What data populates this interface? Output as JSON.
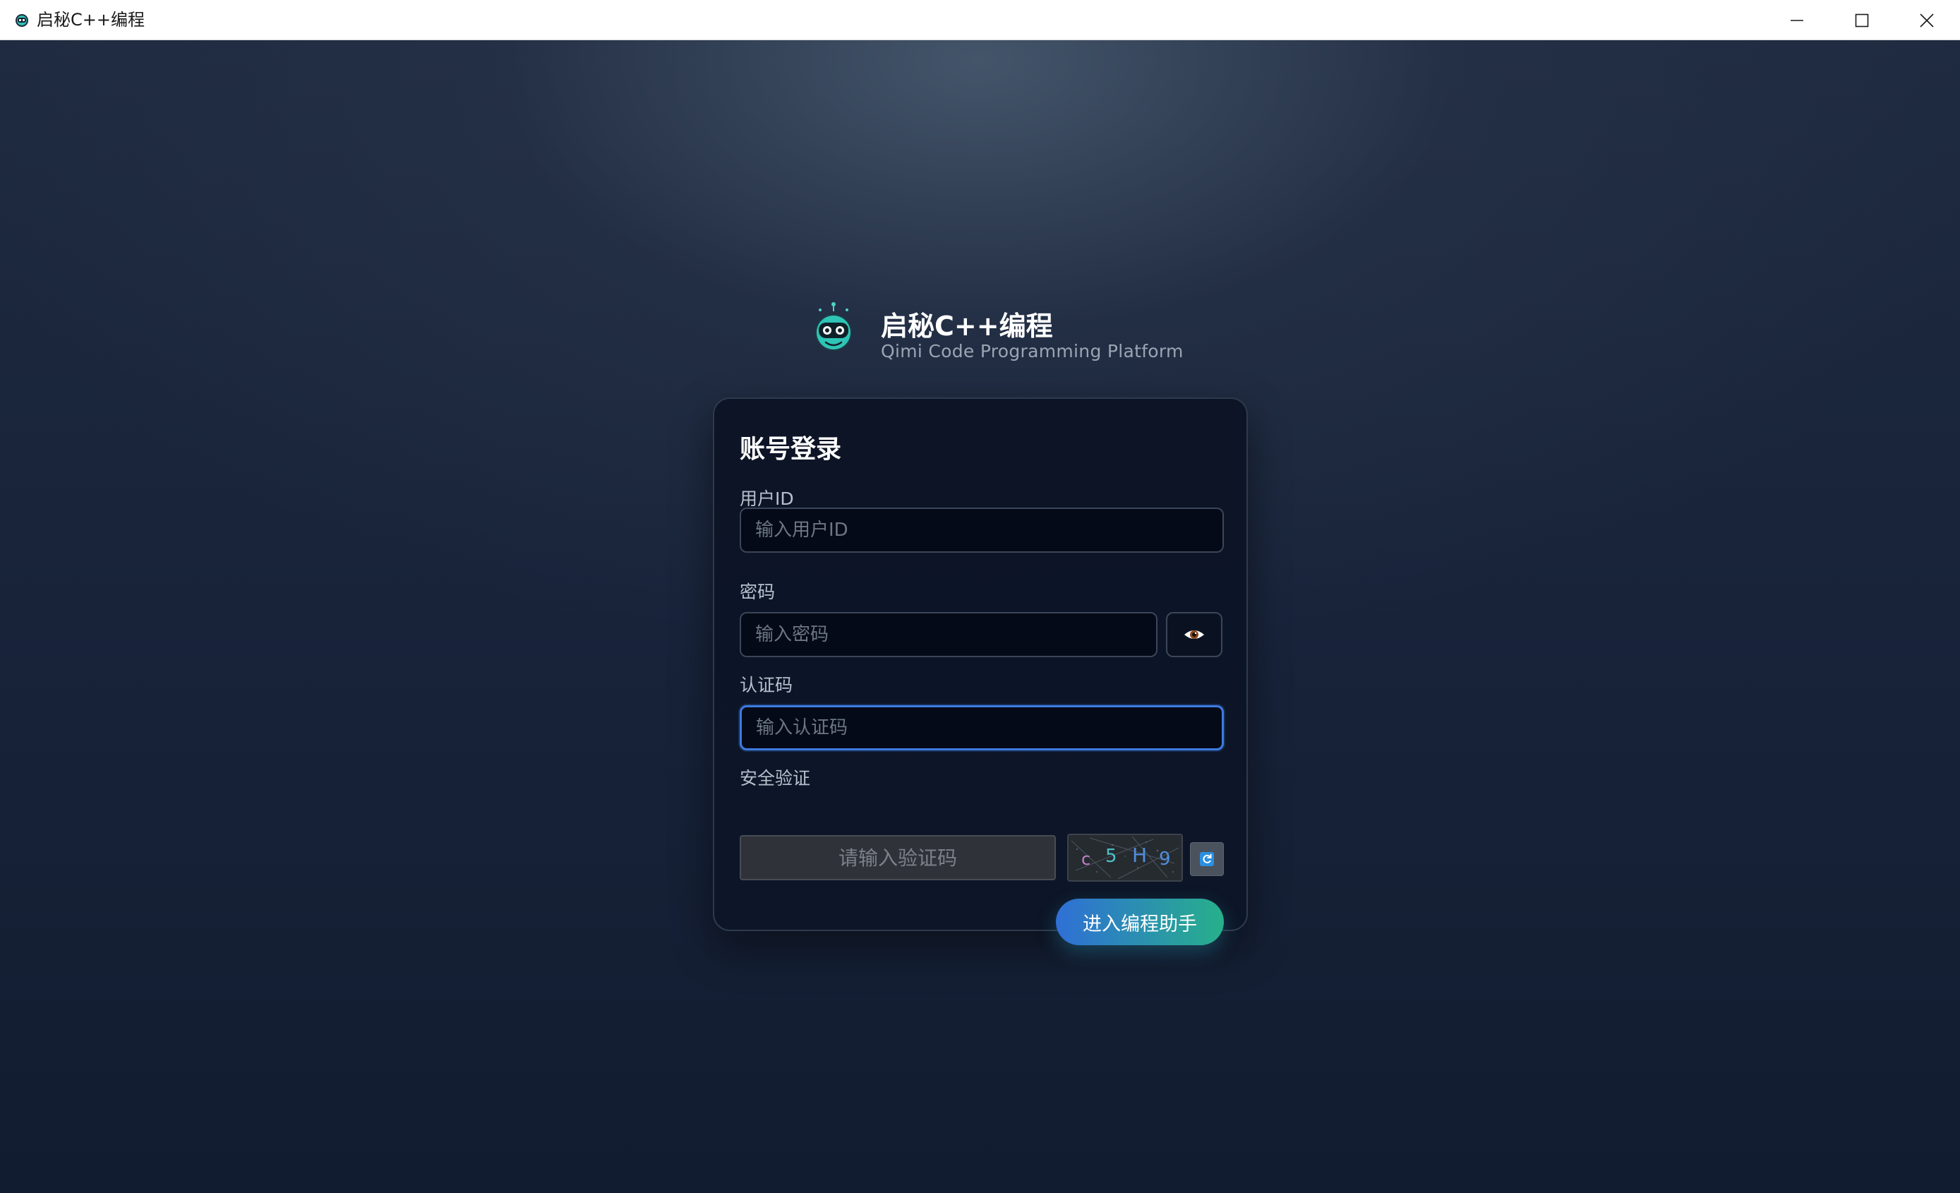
{
  "window": {
    "title": "启秘C++编程",
    "controls": [
      "minimize-icon",
      "maximize-icon",
      "close-icon"
    ]
  },
  "brand": {
    "name": "启秘C++编程",
    "tagline": "Qimi Code Programming Platform",
    "logo_icon": "robot-icon"
  },
  "login": {
    "title": "账号登录",
    "user_id": {
      "label": "用户ID",
      "placeholder": "输入用户ID",
      "value": ""
    },
    "password": {
      "label": "密码",
      "placeholder": "输入密码",
      "value": "",
      "toggle_icon": "eye-icon"
    },
    "auth_code": {
      "label": "认证码",
      "placeholder": "输入认证码",
      "value": "",
      "focused": true
    },
    "security": {
      "label": "安全验证",
      "placeholder": "请输入验证码",
      "captcha_chars": [
        "c",
        "5",
        "H",
        "9"
      ],
      "refresh_icon": "refresh-icon"
    },
    "submit_label": "进入编程助手"
  },
  "colors": {
    "background": "#18233a",
    "card": "#0c1426",
    "focus_border": "#3d7be0",
    "button_gradient_start": "#2f6fd6",
    "button_gradient_end": "#27b08a",
    "brand_accent": "#2ec4b6"
  }
}
